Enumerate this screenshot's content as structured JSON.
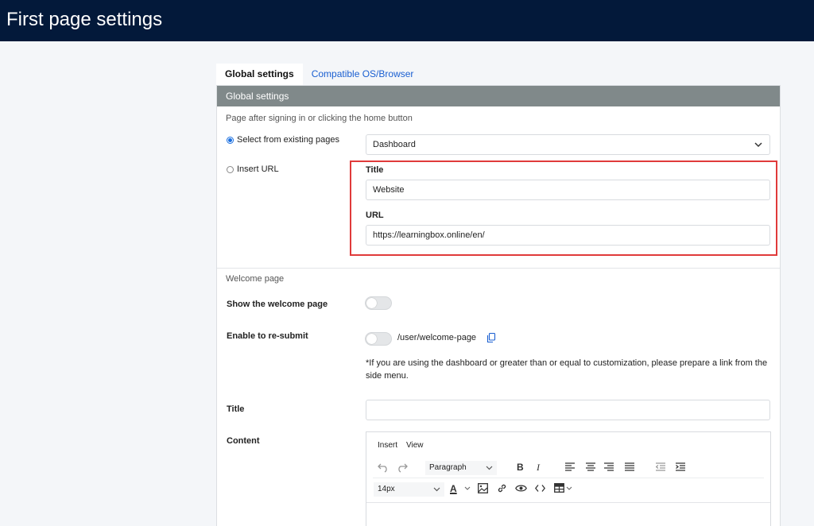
{
  "header": {
    "title": "First page settings"
  },
  "tabs": [
    {
      "label": "Global settings",
      "active": true
    },
    {
      "label": "Compatible OS/Browser",
      "active": false
    }
  ],
  "panel": {
    "title": "Global settings",
    "page_after_signin": {
      "description": "Page after signing in or clicking the home button",
      "option_existing": {
        "label": "Select from existing pages",
        "selected": true
      },
      "existing_select_value": "Dashboard",
      "option_url": {
        "label": "Insert URL",
        "selected": false
      },
      "title_label": "Title",
      "title_value": "Website",
      "url_label": "URL",
      "url_value": "https://learningbox.online/en/"
    },
    "welcome": {
      "section_label": "Welcome page",
      "show_label": "Show the welcome page",
      "resubmit_label": "Enable to re-submit",
      "resubmit_path": "/user/welcome-page",
      "note_line1": "*If you are using the dashboard or greater than or equal to customization, please prepare a link from the",
      "note_line2": "side menu.",
      "title_label": "Title",
      "title_value": "",
      "content_label": "Content"
    },
    "editor": {
      "menu": [
        "Insert",
        "View"
      ],
      "block_format": "Paragraph",
      "font_size": "14px",
      "bold": "B",
      "italic": "I",
      "text_color_glyph": "A"
    }
  },
  "colors": {
    "header_bg": "#03193a",
    "panel_header_bg": "#80898a",
    "link": "#1a5fd1",
    "highlight": "#e03a3a",
    "radio_active": "#1a6fe0"
  }
}
